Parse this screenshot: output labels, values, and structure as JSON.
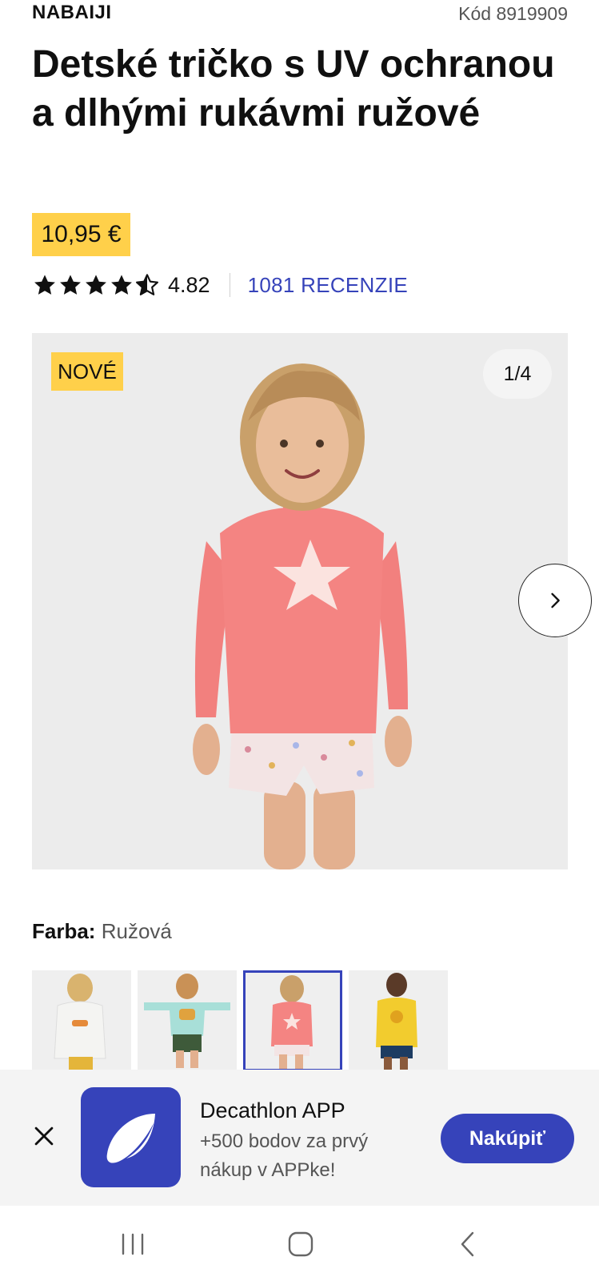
{
  "header": {
    "brand": "NABAIJI",
    "product_code": "Kód 8919909"
  },
  "product": {
    "title": "Detské tričko s UV ochranou a dlhými rukávmi ružové",
    "price": "10,95 €",
    "rating": {
      "value": "4.82",
      "stars": 4.82,
      "stars_max": 5,
      "reviews_link": "1081 RECENZIE"
    }
  },
  "gallery": {
    "badge": "NOVÉ",
    "counter": "1/4",
    "next_icon": "chevron-right-icon"
  },
  "color": {
    "label": "Farba:",
    "value": "Ružová",
    "selected_index": 2,
    "swatches": [
      "white-shirt",
      "mint-shirt",
      "pink-shirt",
      "yellow-shirt"
    ]
  },
  "app_banner": {
    "title": "Decathlon APP",
    "subtitle": "+500 bodov za prvý nákup v APPke!",
    "button": "Nakúpiť",
    "close_icon": "close-icon",
    "logo_icon": "decathlon-logo-icon"
  },
  "system_nav": {
    "recents_icon": "recents-icon",
    "home_icon": "home-icon",
    "back_icon": "back-icon"
  },
  "colors": {
    "accent": "#3643ba",
    "highlight": "#ffd04a",
    "text": "#101010",
    "muted": "#555555",
    "banner_bg": "#f4f4f4"
  }
}
